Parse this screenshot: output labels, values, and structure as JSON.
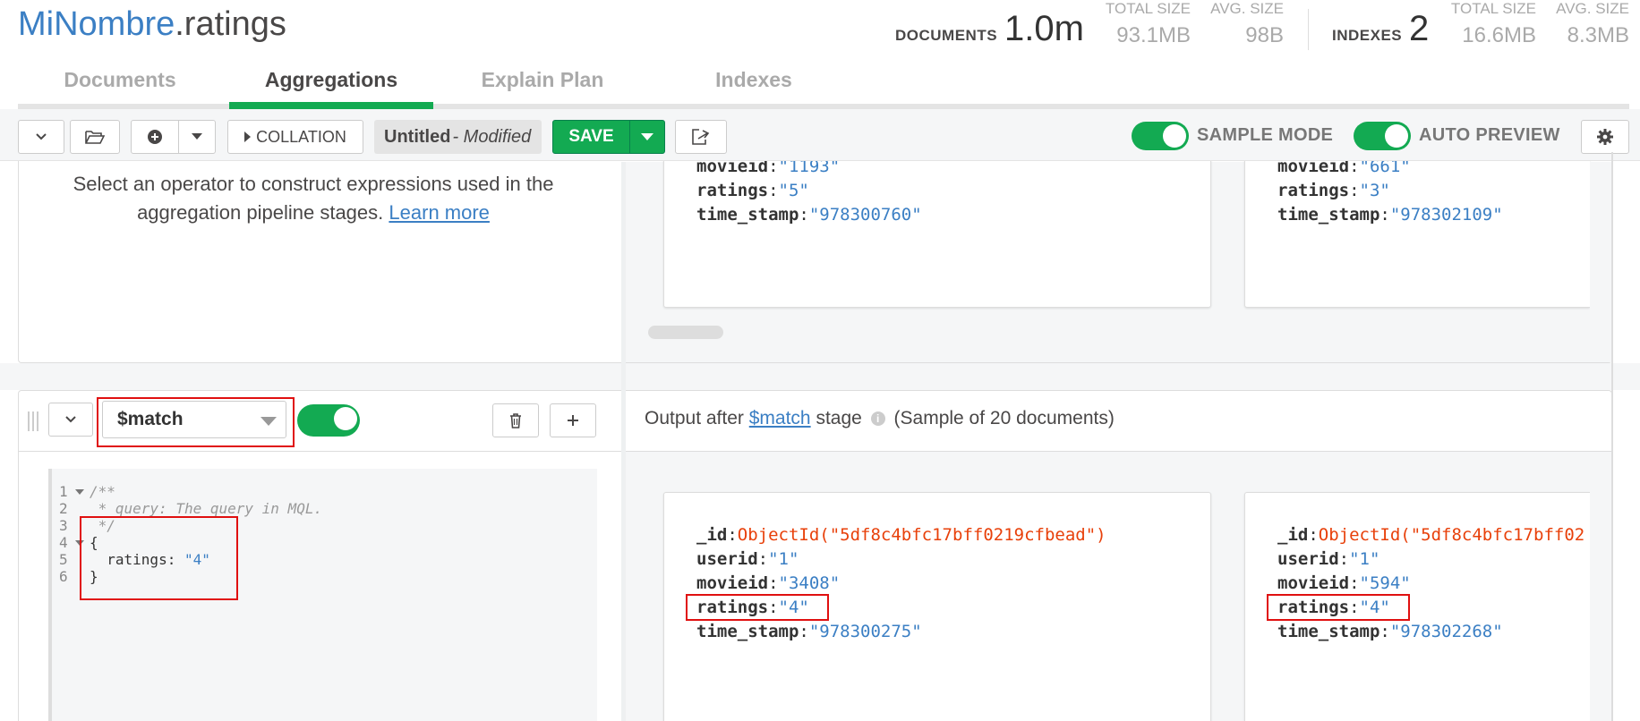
{
  "header": {
    "db": "MiNombre",
    "collection": ".ratings",
    "documents_label": "DOCUMENTS",
    "documents_value": "1.0m",
    "docs_total_size_label": "TOTAL SIZE",
    "docs_total_size_value": "93.1MB",
    "docs_avg_size_label": "AVG. SIZE",
    "docs_avg_size_value": "98B",
    "indexes_label": "INDEXES",
    "indexes_value": "2",
    "idx_total_size_label": "TOTAL SIZE",
    "idx_total_size_value": "16.6MB",
    "idx_avg_size_label": "AVG. SIZE",
    "idx_avg_size_value": "8.3MB"
  },
  "tabs": [
    {
      "label": "Documents"
    },
    {
      "label": "Aggregations"
    },
    {
      "label": "Explain Plan"
    },
    {
      "label": "Indexes"
    }
  ],
  "toolbar": {
    "collation_label": "COLLATION",
    "pipeline_name": "Untitled",
    "modified_label": "- Modified",
    "save_label": "SAVE",
    "sample_mode_label": "SAMPLE MODE",
    "auto_preview_label": "AUTO PREVIEW"
  },
  "top_stage": {
    "info_text": "Select an operator to construct expressions used in the aggregation pipeline stages.",
    "learn_more": "Learn more",
    "docs": [
      {
        "fields": [
          {
            "key": "movieid",
            "value": "\"1193\""
          },
          {
            "key": "ratings",
            "value": "\"5\""
          },
          {
            "key": "time_stamp",
            "value": "\"978300760\""
          }
        ]
      },
      {
        "fields": [
          {
            "key": "movieid",
            "value": "\"661\""
          },
          {
            "key": "ratings",
            "value": "\"3\""
          },
          {
            "key": "time_stamp",
            "value": "\"978302109\""
          }
        ]
      }
    ]
  },
  "match_stage": {
    "operator": "$match",
    "output_prefix": "Output after",
    "output_operator": "$match",
    "output_suffix": "stage",
    "sample_note": "(Sample of 20 documents)",
    "code_lines": [
      {
        "num": "1",
        "text": "/**"
      },
      {
        "num": "2",
        "text": " * query: The query in MQL."
      },
      {
        "num": "3",
        "text": " */"
      },
      {
        "num": "4",
        "text": "{"
      },
      {
        "num": "5",
        "key": "  ratings: ",
        "str": "\"4\""
      },
      {
        "num": "6",
        "text": "}"
      }
    ],
    "docs": [
      {
        "fields": [
          {
            "key": "_id",
            "value": "ObjectId(\"5df8c4bfc17bff0219cfbead\")"
          },
          {
            "key": "userid",
            "value": "\"1\""
          },
          {
            "key": "movieid",
            "value": "\"3408\""
          },
          {
            "key": "ratings",
            "value": "\"4\""
          },
          {
            "key": "time_stamp",
            "value": "\"978300275\""
          }
        ]
      },
      {
        "fields": [
          {
            "key": "_id",
            "value": "ObjectId(\"5df8c4bfc17bff02"
          },
          {
            "key": "userid",
            "value": "\"1\""
          },
          {
            "key": "movieid",
            "value": "\"594\""
          },
          {
            "key": "ratings",
            "value": "\"4\""
          },
          {
            "key": "time_stamp",
            "value": "\"978302268\""
          }
        ]
      }
    ]
  },
  "colors": {
    "accent": "#13aa52",
    "link": "#3b7fc4",
    "objectid": "#e8400a",
    "highlight": "#e01010"
  }
}
